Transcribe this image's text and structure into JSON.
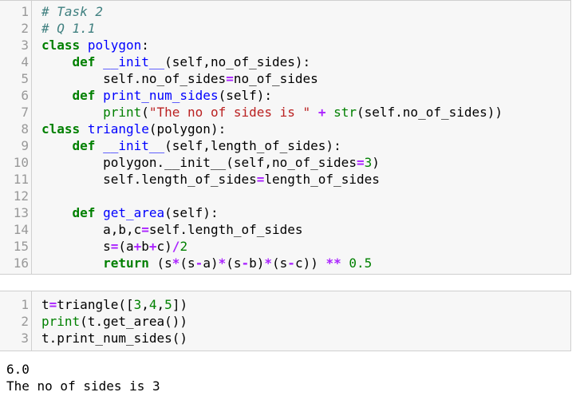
{
  "cells": [
    {
      "lines": [
        {
          "n": "1",
          "seg": [
            {
              "t": "# Task 2",
              "c": "cm"
            }
          ]
        },
        {
          "n": "2",
          "seg": [
            {
              "t": "# Q 1.1",
              "c": "cm"
            }
          ]
        },
        {
          "n": "3",
          "seg": [
            {
              "t": "class",
              "c": "kw"
            },
            {
              "t": " "
            },
            {
              "t": "polygon",
              "c": "fn"
            },
            {
              "t": ":"
            }
          ]
        },
        {
          "n": "4",
          "seg": [
            {
              "t": "    "
            },
            {
              "t": "def",
              "c": "kw"
            },
            {
              "t": " "
            },
            {
              "t": "__init__",
              "c": "fn"
            },
            {
              "t": "(self,no_of_sides):"
            }
          ]
        },
        {
          "n": "5",
          "seg": [
            {
              "t": "        self.no_of_sides"
            },
            {
              "t": "=",
              "c": "op"
            },
            {
              "t": "no_of_sides"
            }
          ]
        },
        {
          "n": "6",
          "seg": [
            {
              "t": "    "
            },
            {
              "t": "def",
              "c": "kw"
            },
            {
              "t": " "
            },
            {
              "t": "print_num_sides",
              "c": "fn"
            },
            {
              "t": "(self):"
            }
          ]
        },
        {
          "n": "7",
          "seg": [
            {
              "t": "        "
            },
            {
              "t": "print",
              "c": "bi"
            },
            {
              "t": "("
            },
            {
              "t": "\"The no of sides is \"",
              "c": "st"
            },
            {
              "t": " "
            },
            {
              "t": "+",
              "c": "op"
            },
            {
              "t": " "
            },
            {
              "t": "str",
              "c": "bi"
            },
            {
              "t": "(self.no_of_sides))"
            }
          ]
        },
        {
          "n": "8",
          "seg": [
            {
              "t": "class",
              "c": "kw"
            },
            {
              "t": " "
            },
            {
              "t": "triangle",
              "c": "fn"
            },
            {
              "t": "(polygon):"
            }
          ]
        },
        {
          "n": "9",
          "seg": [
            {
              "t": "    "
            },
            {
              "t": "def",
              "c": "kw"
            },
            {
              "t": " "
            },
            {
              "t": "__init__",
              "c": "fn"
            },
            {
              "t": "(self,length_of_sides):"
            }
          ]
        },
        {
          "n": "10",
          "seg": [
            {
              "t": "        polygon.__init__(self,no_of_sides"
            },
            {
              "t": "=",
              "c": "op"
            },
            {
              "t": "3",
              "c": "nu"
            },
            {
              "t": ")"
            }
          ]
        },
        {
          "n": "11",
          "seg": [
            {
              "t": "        self.length_of_sides"
            },
            {
              "t": "=",
              "c": "op"
            },
            {
              "t": "length_of_sides"
            }
          ]
        },
        {
          "n": "12",
          "seg": [
            {
              "t": ""
            }
          ]
        },
        {
          "n": "13",
          "seg": [
            {
              "t": "    "
            },
            {
              "t": "def",
              "c": "kw"
            },
            {
              "t": " "
            },
            {
              "t": "get_area",
              "c": "fn"
            },
            {
              "t": "(self):"
            }
          ]
        },
        {
          "n": "14",
          "seg": [
            {
              "t": "        a,b,c"
            },
            {
              "t": "=",
              "c": "op"
            },
            {
              "t": "self.length_of_sides"
            }
          ]
        },
        {
          "n": "15",
          "seg": [
            {
              "t": "        s"
            },
            {
              "t": "=",
              "c": "op"
            },
            {
              "t": "(a"
            },
            {
              "t": "+",
              "c": "op"
            },
            {
              "t": "b"
            },
            {
              "t": "+",
              "c": "op"
            },
            {
              "t": "c)"
            },
            {
              "t": "/",
              "c": "op"
            },
            {
              "t": "2",
              "c": "nu"
            }
          ]
        },
        {
          "n": "16",
          "seg": [
            {
              "t": "        "
            },
            {
              "t": "return",
              "c": "kw"
            },
            {
              "t": " (s"
            },
            {
              "t": "*",
              "c": "op"
            },
            {
              "t": "(s"
            },
            {
              "t": "-",
              "c": "op"
            },
            {
              "t": "a)"
            },
            {
              "t": "*",
              "c": "op"
            },
            {
              "t": "(s"
            },
            {
              "t": "-",
              "c": "op"
            },
            {
              "t": "b)"
            },
            {
              "t": "*",
              "c": "op"
            },
            {
              "t": "(s"
            },
            {
              "t": "-",
              "c": "op"
            },
            {
              "t": "c)) "
            },
            {
              "t": "**",
              "c": "op"
            },
            {
              "t": " "
            },
            {
              "t": "0.5",
              "c": "nu"
            }
          ]
        }
      ]
    },
    {
      "lines": [
        {
          "n": "1",
          "seg": [
            {
              "t": "t"
            },
            {
              "t": "=",
              "c": "op"
            },
            {
              "t": "triangle([",
              "c": ""
            },
            {
              "t": "3",
              "c": "nu"
            },
            {
              "t": ","
            },
            {
              "t": "4",
              "c": "nu"
            },
            {
              "t": ","
            },
            {
              "t": "5",
              "c": "nu"
            },
            {
              "t": "])"
            }
          ]
        },
        {
          "n": "2",
          "seg": [
            {
              "t": "print",
              "c": "bi"
            },
            {
              "t": "(t.get_area())"
            }
          ]
        },
        {
          "n": "3",
          "seg": [
            {
              "t": "t.print_num_sides()"
            }
          ]
        }
      ]
    }
  ],
  "output": {
    "line1": "6.0",
    "line2": "The no of sides is 3"
  }
}
